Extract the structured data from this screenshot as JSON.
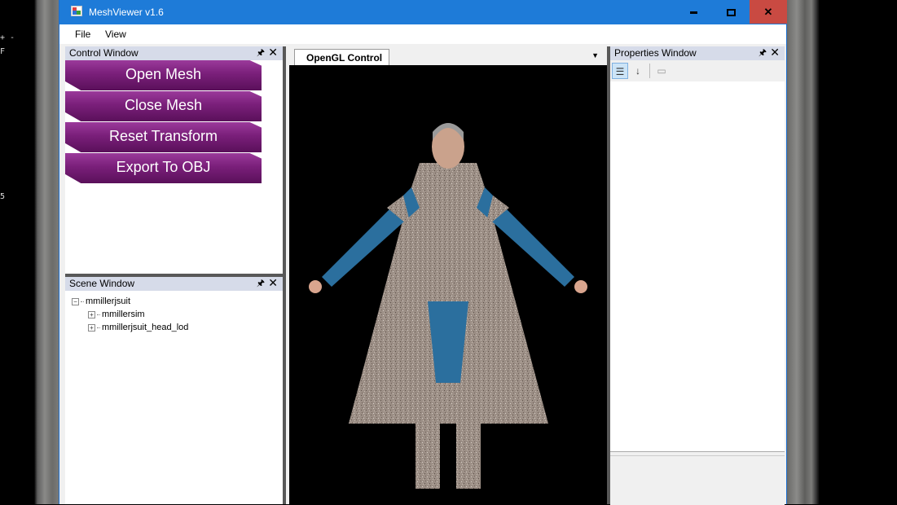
{
  "window": {
    "title": "MeshViewer v1.6"
  },
  "menu": {
    "file": "File",
    "view": "View"
  },
  "control_window": {
    "title": "Control Window",
    "buttons": [
      "Open Mesh",
      "Close Mesh",
      "Reset Transform",
      "Export To OBJ"
    ]
  },
  "scene_window": {
    "title": "Scene Window",
    "root": "mmillerjsuit",
    "children": [
      "mmillersim",
      "mmillerjsuit_head_lod"
    ]
  },
  "gl": {
    "tab": "OpenGL Control"
  },
  "properties_window": {
    "title": "Properties Window"
  },
  "desktop": {
    "frag1": "+ -",
    "frag2": "F",
    "frag3": "5"
  },
  "colors": {
    "titlebar": "#1e7bd8",
    "button": "#7a1f7a",
    "close": "#c94a42"
  }
}
